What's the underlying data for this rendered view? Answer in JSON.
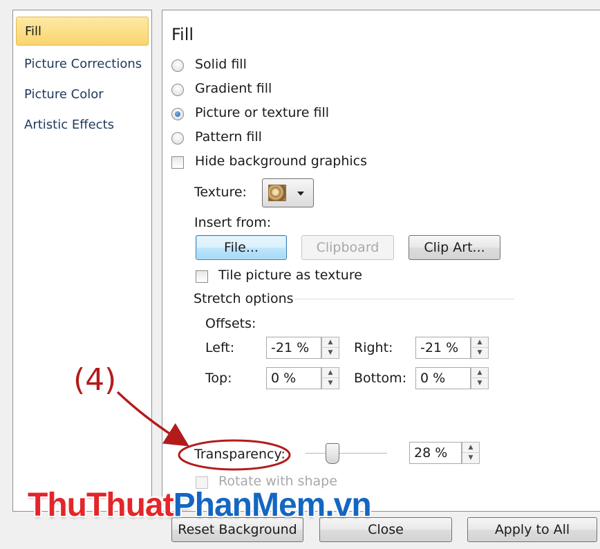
{
  "categories": [
    {
      "label": "Fill",
      "selected": true
    },
    {
      "label": "Picture Corrections",
      "selected": false
    },
    {
      "label": "Picture Color",
      "selected": false
    },
    {
      "label": "Artistic Effects",
      "selected": false
    }
  ],
  "panel_title": "Fill",
  "fill_options": {
    "solid": {
      "label": "Solid fill",
      "checked": false
    },
    "gradient": {
      "label": "Gradient fill",
      "checked": false
    },
    "picture": {
      "label": "Picture or texture fill",
      "checked": true
    },
    "pattern": {
      "label": "Pattern fill",
      "checked": false
    }
  },
  "hide_background": {
    "label": "Hide background graphics",
    "checked": false
  },
  "texture": {
    "label": "Texture:",
    "icon": "texture-swatch-icon"
  },
  "insert_from": {
    "label": "Insert from:",
    "file_button": "File...",
    "clipboard_button": "Clipboard",
    "clip_art_button": "Clip Art..."
  },
  "tile_picture": {
    "label": "Tile picture as texture",
    "checked": false
  },
  "stretch": {
    "section_label": "Stretch options",
    "offsets_label": "Offsets:",
    "left": {
      "label": "Left:",
      "value": "-21 %"
    },
    "right": {
      "label": "Right:",
      "value": "-21 %"
    },
    "top": {
      "label": "Top:",
      "value": "0 %"
    },
    "bottom": {
      "label": "Bottom:",
      "value": "0 %"
    }
  },
  "transparency": {
    "label": "Transparency:",
    "value": "28 %",
    "percent": 28
  },
  "rotate_with_shape": {
    "label": "Rotate with shape",
    "checked": false,
    "enabled": false
  },
  "footer": {
    "reset_button": "Reset Background",
    "close_button": "Close",
    "apply_all_button": "Apply to All"
  },
  "annotation": {
    "label": "(4)",
    "color": "#b31b1b"
  },
  "watermark": {
    "part1": "ThuThuat",
    "part2": "PhanMem",
    "part3": ".vn"
  },
  "colors": {
    "selected_item": "#fad56f",
    "accent": "#3c7fb1",
    "annotation": "#b31b1b"
  }
}
